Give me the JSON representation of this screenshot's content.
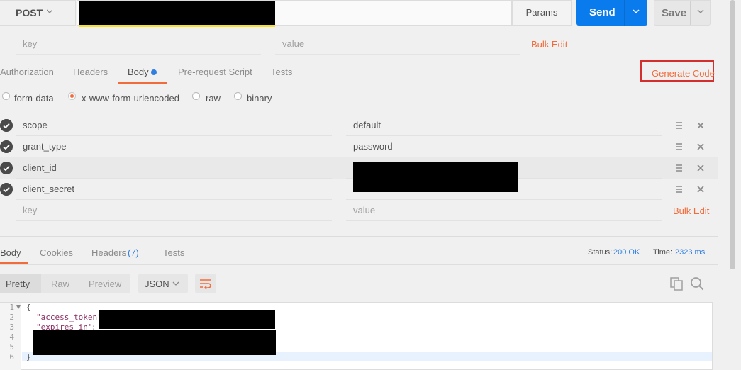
{
  "request": {
    "method": "POST",
    "params_label": "Params",
    "send_label": "Send",
    "save_label": "Save"
  },
  "params_row": {
    "key_placeholder": "key",
    "value_placeholder": "value",
    "bulk_edit": "Bulk Edit"
  },
  "request_tabs": [
    {
      "label": "Authorization"
    },
    {
      "label": "Headers"
    },
    {
      "label": "Body",
      "active": true
    },
    {
      "label": "Pre-request Script"
    },
    {
      "label": "Tests"
    }
  ],
  "generate_code": "Generate Code",
  "body_modes": [
    {
      "label": "form-data",
      "selected": false
    },
    {
      "label": "x-www-form-urlencoded",
      "selected": true
    },
    {
      "label": "raw",
      "selected": false
    },
    {
      "label": "binary",
      "selected": false
    }
  ],
  "form_rows": [
    {
      "key": "scope",
      "value": "default"
    },
    {
      "key": "grant_type",
      "value": "password"
    },
    {
      "key": "client_id",
      "value": ""
    },
    {
      "key": "client_secret",
      "value": ""
    }
  ],
  "form_new_row": {
    "key_placeholder": "key",
    "value_placeholder": "value",
    "bulk_edit": "Bulk Edit"
  },
  "response": {
    "tabs": [
      {
        "label": "Body",
        "active": true
      },
      {
        "label": "Cookies"
      },
      {
        "label": "Headers"
      },
      {
        "label": "Tests"
      }
    ],
    "headers_count": "(7)",
    "status_label": "Status:",
    "status_value": "200 OK",
    "time_label": "Time:",
    "time_value": "2323 ms",
    "view_modes": [
      "Pretty",
      "Raw",
      "Preview"
    ],
    "format": "JSON",
    "code_lines": {
      "l1": "{",
      "l2_key": "\"access_token\"",
      "l3_key": "\"expires_in\"",
      "l3_sep": ":",
      "l6": "}"
    },
    "line_numbers": [
      "1",
      "2",
      "3",
      "4",
      "5",
      "6"
    ]
  },
  "colors": {
    "accent": "#f26b3a",
    "send": "#097bed",
    "status": "#2f7fe0"
  }
}
